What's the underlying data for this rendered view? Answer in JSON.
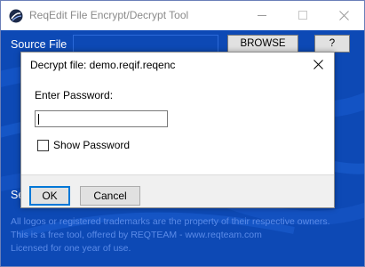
{
  "window": {
    "title": "ReqEdit File Encrypt/Decrypt Tool",
    "icon": "app-logo-icon"
  },
  "main": {
    "source_label": "Source File",
    "source_value": "",
    "browse_label": "BROWSE",
    "help_label": "?",
    "second_label": "Se",
    "footer_lines": [
      "All logos or registered trademarks are the property of their respective owners.",
      "This is a free tool, offered by REQTEAM - www.reqteam.com",
      "Licensed for one year of use."
    ]
  },
  "dialog": {
    "title": "Decrypt file: demo.reqif.reqenc",
    "password_label": "Enter Password:",
    "password_value": "",
    "show_password_label": "Show Password",
    "show_password_checked": false,
    "ok_label": "OK",
    "cancel_label": "Cancel"
  },
  "colors": {
    "client_background": "#0d49b5",
    "footer_text": "#5b8be8",
    "focus_border": "#0078d7"
  }
}
